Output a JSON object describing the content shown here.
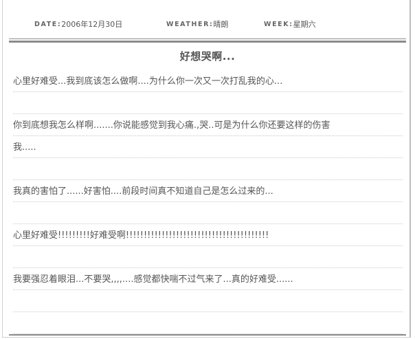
{
  "header": {
    "date_label": "DATE:",
    "date_value": "2006年12月30日",
    "weather_label": "WEATHER:",
    "weather_value": "晴朗",
    "week_label": "WEEK:",
    "week_value": "星期六"
  },
  "post": {
    "title": "好想哭啊...",
    "lines": [
      "心里好难受...我到底该怎么做啊....为什么你一次又一次打乱我的心...",
      "",
      "你到底想我怎么样啊.......你说能感觉到我心痛.,哭..可是为什么你还要这样的伤害",
      "我.....",
      "",
      "我真的害怕了......好害怕....前段时间真不知道自己是怎么过来的...",
      "",
      "心里好难受!!!!!!!!!好难受啊!!!!!!!!!!!!!!!!!!!!!!!!!!!!!!!!!!!!!!!!",
      "",
      "我要强忍着眼泪...不要哭,,,,....感觉都快喘不过气来了...真的好难受......",
      "",
      "",
      ""
    ]
  }
}
